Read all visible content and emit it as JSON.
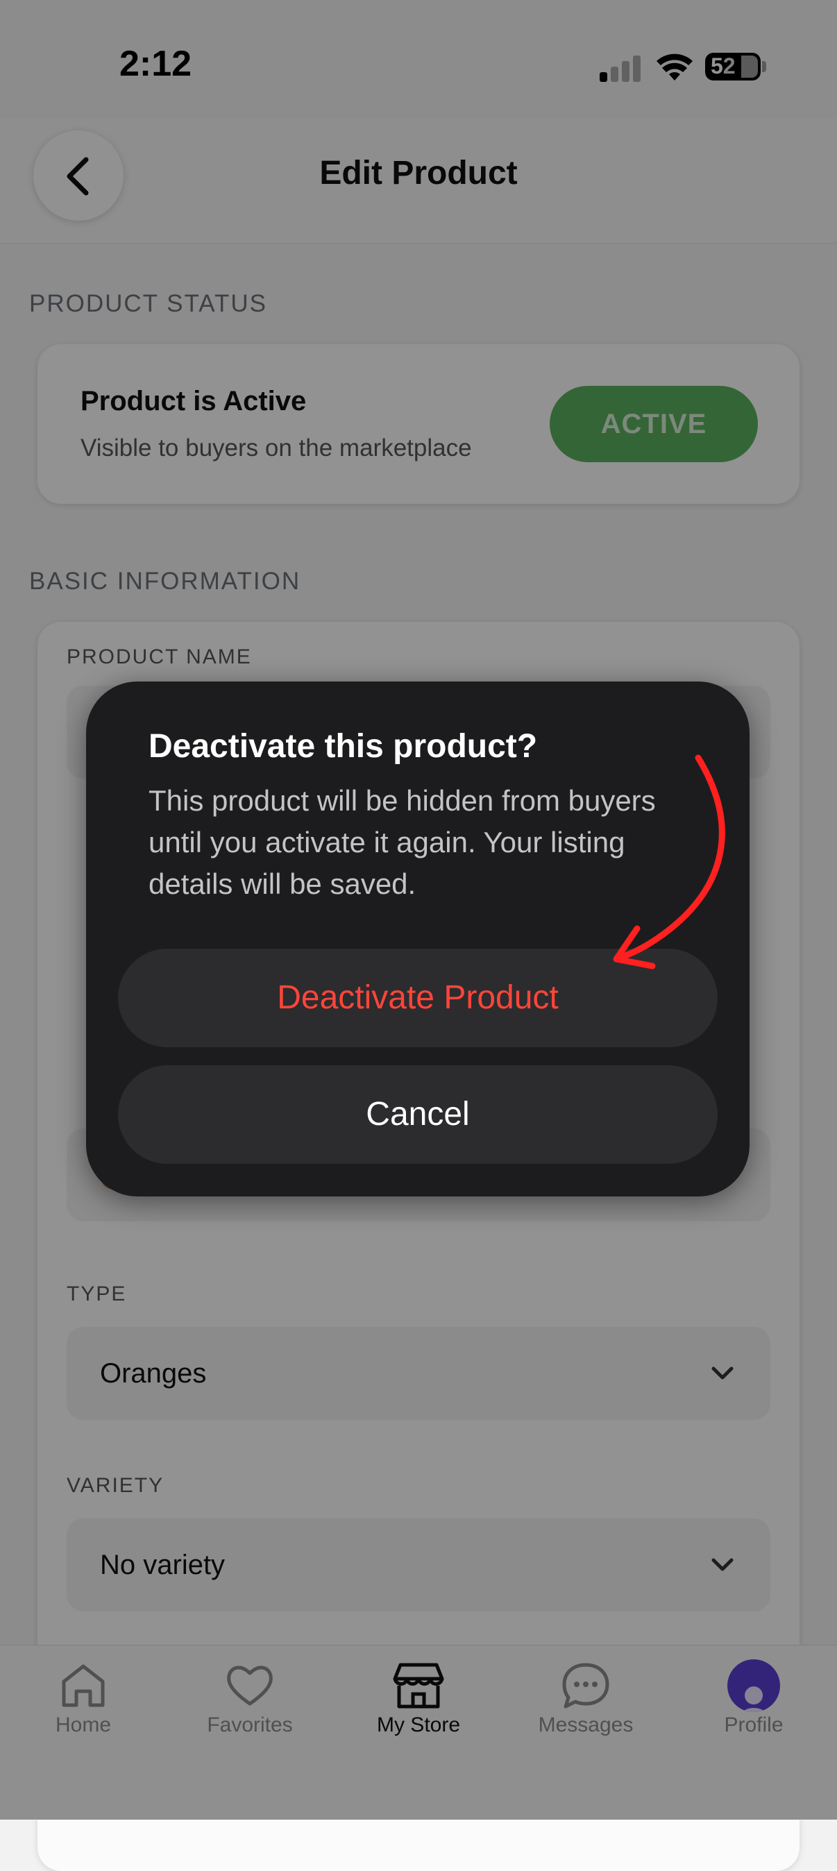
{
  "status_bar": {
    "time": "2:12",
    "battery_tens": "5",
    "battery_ones": "2"
  },
  "header": {
    "title": "Edit Product",
    "back_icon": "chevron-left-icon"
  },
  "product_status": {
    "section_title": "PRODUCT STATUS",
    "heading": "Product is Active",
    "description": "Visible to buyers on the marketplace",
    "badge": "ACTIVE",
    "badge_color": "#5aaf5d"
  },
  "basic_info": {
    "section_title": "BASIC INFORMATION",
    "fields": {
      "product_name_label": "PRODUCT NAME",
      "type_label": "TYPE",
      "type_value": "Oranges",
      "variety_label": "VARIETY",
      "variety_value": "No variety"
    }
  },
  "dialog": {
    "title": "Deactivate this product?",
    "message": "This product will be hidden from buyers until you activate it again. Your listing details will be saved.",
    "confirm_label": "Deactivate Product",
    "cancel_label": "Cancel",
    "confirm_color": "#ff453a",
    "annotation_arrow_color": "#ff2020"
  },
  "tab_bar": {
    "tabs": [
      {
        "label": "Home",
        "icon": "home-icon"
      },
      {
        "label": "Favorites",
        "icon": "heart-icon"
      },
      {
        "label": "My Store",
        "icon": "store-icon",
        "active": true
      },
      {
        "label": "Messages",
        "icon": "chat-bubble-icon"
      },
      {
        "label": "Profile",
        "icon": "avatar-icon"
      }
    ]
  }
}
